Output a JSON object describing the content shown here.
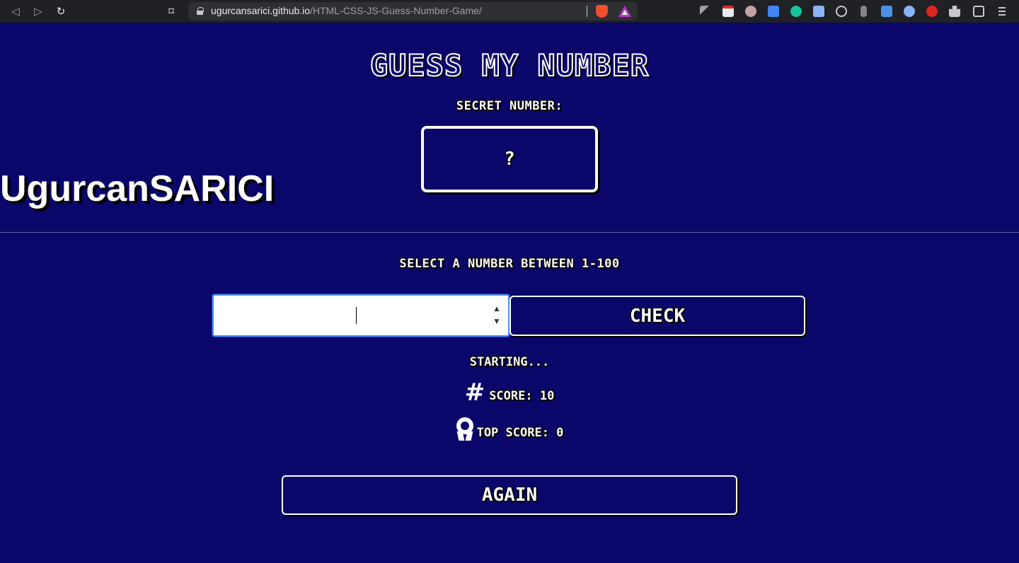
{
  "browser": {
    "url_host": "ugurcansarici.github.io",
    "url_path": "/HTML-CSS-JS-Guess-Number-Game/",
    "icons": {
      "back": "◁",
      "forward": "▷",
      "reload": "↻",
      "bookmark": "⌑"
    }
  },
  "game": {
    "title": "GUESS MY NUMBER",
    "secret_label": "SECRET NUMBER:",
    "secret_value": "?",
    "author": "UgurcanSARICI",
    "range_label": "SELECT A NUMBER BETWEEN 1-100",
    "guess_value": "",
    "check_label": "CHECK",
    "status": "STARTING...",
    "score_label": "SCORE: 10",
    "score_icon": "#",
    "top_score_label": "TOP SCORE: 0",
    "again_label": "AGAIN"
  },
  "colors": {
    "background": "#0b0669",
    "text": "#ffffff",
    "input_focus": "#4c8bf5"
  }
}
